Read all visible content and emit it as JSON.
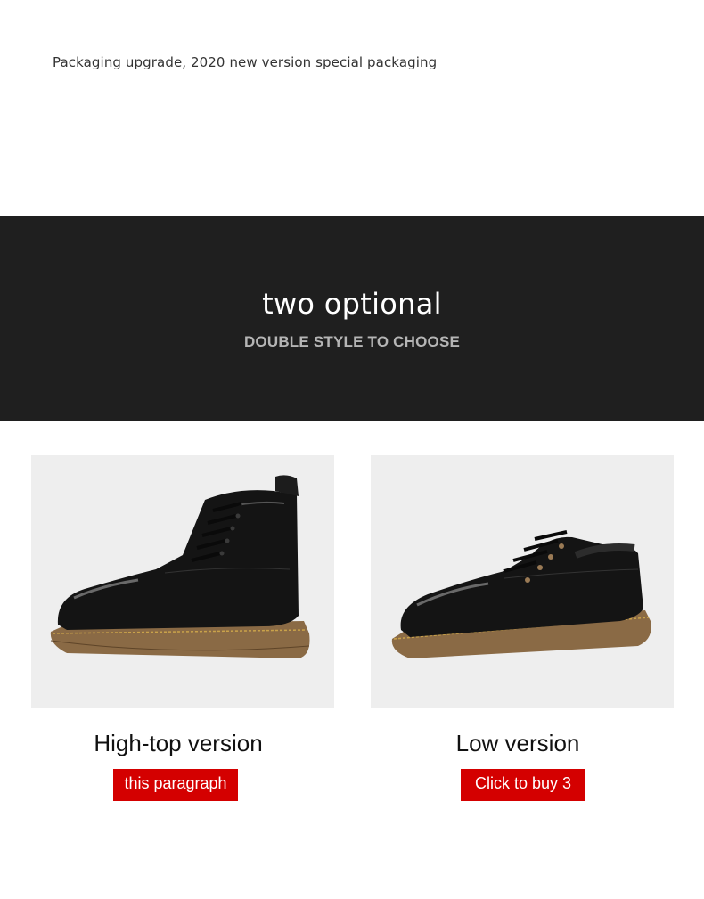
{
  "packaging": {
    "note": "Packaging upgrade, 2020 new version special packaging"
  },
  "banner": {
    "title": "two optional",
    "subtitle": "DOUBLE STYLE TO CHOOSE",
    "background_color": "#1f1f1f"
  },
  "products": [
    {
      "name": "High-top version",
      "button_label": "this paragraph",
      "image_icon": "high-top-boot-image"
    },
    {
      "name": "Low version",
      "button_label": "Click to buy 3",
      "image_icon": "low-shoe-image"
    }
  ],
  "colors": {
    "button": "#d40000",
    "image_background": "#eeeeee"
  }
}
